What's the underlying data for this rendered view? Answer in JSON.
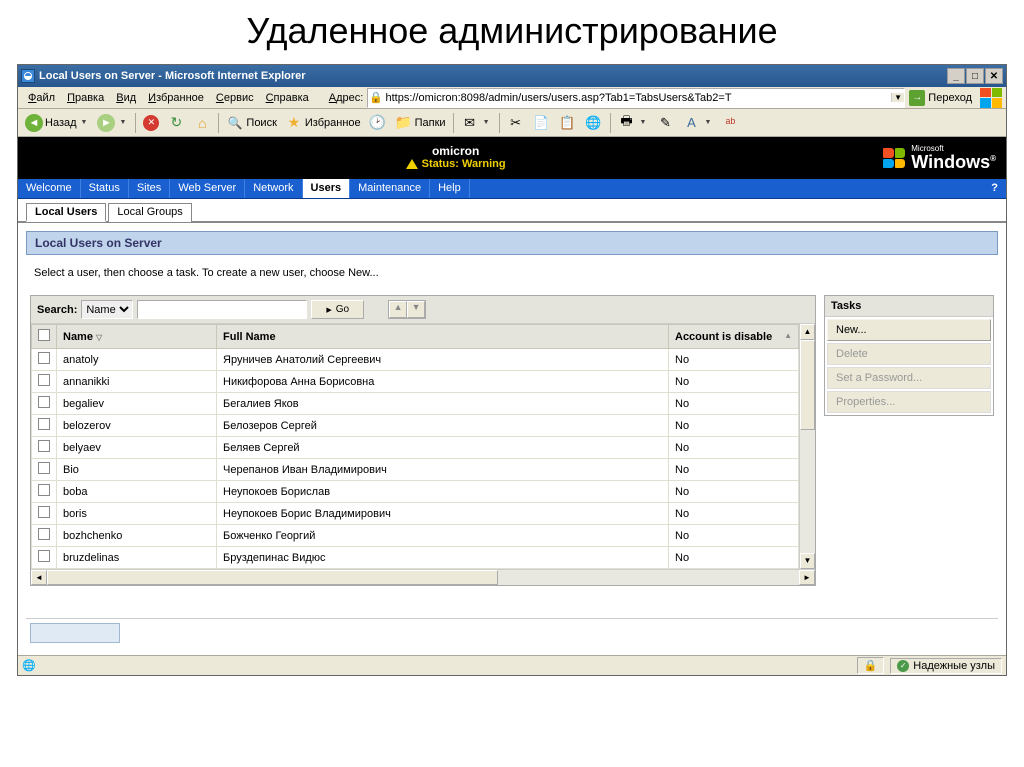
{
  "slide_title": "Удаленное администрирование",
  "titlebar": {
    "title": "Local Users on Server - Microsoft Internet Explorer"
  },
  "menubar": {
    "items": [
      "Файл",
      "Правка",
      "Вид",
      "Избранное",
      "Сервис",
      "Справка"
    ],
    "addr_label": "Адрес:",
    "url": "https://omicron:8098/admin/users/users.asp?Tab1=TabsUsers&Tab2=T",
    "go_label": "Переход"
  },
  "toolbar": {
    "back": "Назад",
    "search": "Поиск",
    "favorites": "Избранное",
    "folders": "Папки"
  },
  "banner": {
    "server": "omicron",
    "status": "Status: Warning",
    "brand_small": "Microsoft",
    "brand_big": "Windows"
  },
  "primary_tabs": [
    "Welcome",
    "Status",
    "Sites",
    "Web Server",
    "Network",
    "Users",
    "Maintenance",
    "Help"
  ],
  "primary_active": "Users",
  "sub_tabs": [
    "Local Users",
    "Local Groups"
  ],
  "sub_active": "Local Users",
  "panel_title": "Local Users on Server",
  "instructions": "Select a user, then choose a task. To create a new user, choose New...",
  "search": {
    "label": "Search:",
    "field": "Name",
    "go": "Go"
  },
  "columns": {
    "name": "Name",
    "fullname": "Full Name",
    "disabled": "Account is disable"
  },
  "users": [
    {
      "name": "anatoly",
      "fullname": "Яруничев Анатолий Сергеевич",
      "disabled": "No"
    },
    {
      "name": "annanikki",
      "fullname": "Никифорова Анна Борисовна",
      "disabled": "No"
    },
    {
      "name": "begaliev",
      "fullname": "Бегалиев Яков",
      "disabled": "No"
    },
    {
      "name": "belozerov",
      "fullname": "Белозеров Сергей",
      "disabled": "No"
    },
    {
      "name": "belyaev",
      "fullname": "Беляев Сергей",
      "disabled": "No"
    },
    {
      "name": "Bio",
      "fullname": "Черепанов Иван Владимирович",
      "disabled": "No"
    },
    {
      "name": "boba",
      "fullname": "Неупокоев Борислав",
      "disabled": "No"
    },
    {
      "name": "boris",
      "fullname": "Неупокоев Борис Владимирович",
      "disabled": "No"
    },
    {
      "name": "bozhchenko",
      "fullname": "Божченко Георгий",
      "disabled": "No"
    },
    {
      "name": "bruzdelinas",
      "fullname": "Бруздепинас Видюс",
      "disabled": "No"
    }
  ],
  "tasks": {
    "header": "Tasks",
    "items": [
      {
        "label": "New...",
        "enabled": true
      },
      {
        "label": "Delete",
        "enabled": false
      },
      {
        "label": "Set a Password...",
        "enabled": false
      },
      {
        "label": "Properties...",
        "enabled": false
      }
    ]
  },
  "statusbar": {
    "zone": "Надежные узлы"
  }
}
